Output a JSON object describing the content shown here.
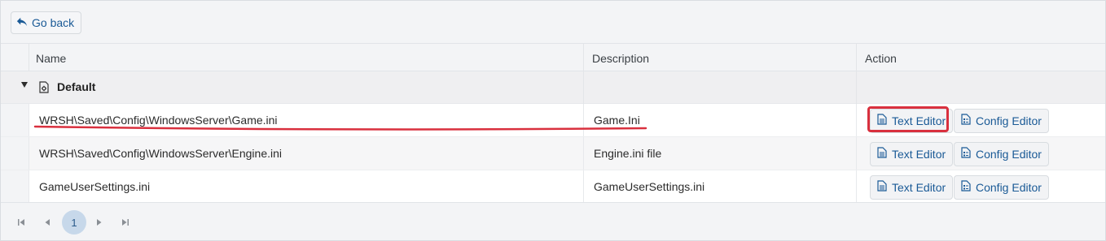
{
  "toolbar": {
    "go_back_label": "Go back"
  },
  "columns": {
    "name": "Name",
    "description": "Description",
    "action": "Action"
  },
  "group": {
    "title": "Default"
  },
  "rows": [
    {
      "name": "WRSH\\Saved\\Config\\WindowsServer\\Game.ini",
      "description": "Game.Ini",
      "text_editor": "Text Editor",
      "config_editor": "Config Editor"
    },
    {
      "name": "WRSH\\Saved\\Config\\WindowsServer\\Engine.ini",
      "description": "Engine.ini file",
      "text_editor": "Text Editor",
      "config_editor": "Config Editor"
    },
    {
      "name": "GameUserSettings.ini",
      "description": "GameUserSettings.ini",
      "text_editor": "Text Editor",
      "config_editor": "Config Editor"
    }
  ],
  "pager": {
    "current_page": "1",
    "first_icon": "first-page-icon",
    "prev_icon": "prev-page-icon",
    "next_icon": "next-page-icon",
    "last_icon": "last-page-icon"
  },
  "colors": {
    "accent": "#1a5a96",
    "highlight": "#d9303e",
    "page_active": "#c7d8ea"
  }
}
